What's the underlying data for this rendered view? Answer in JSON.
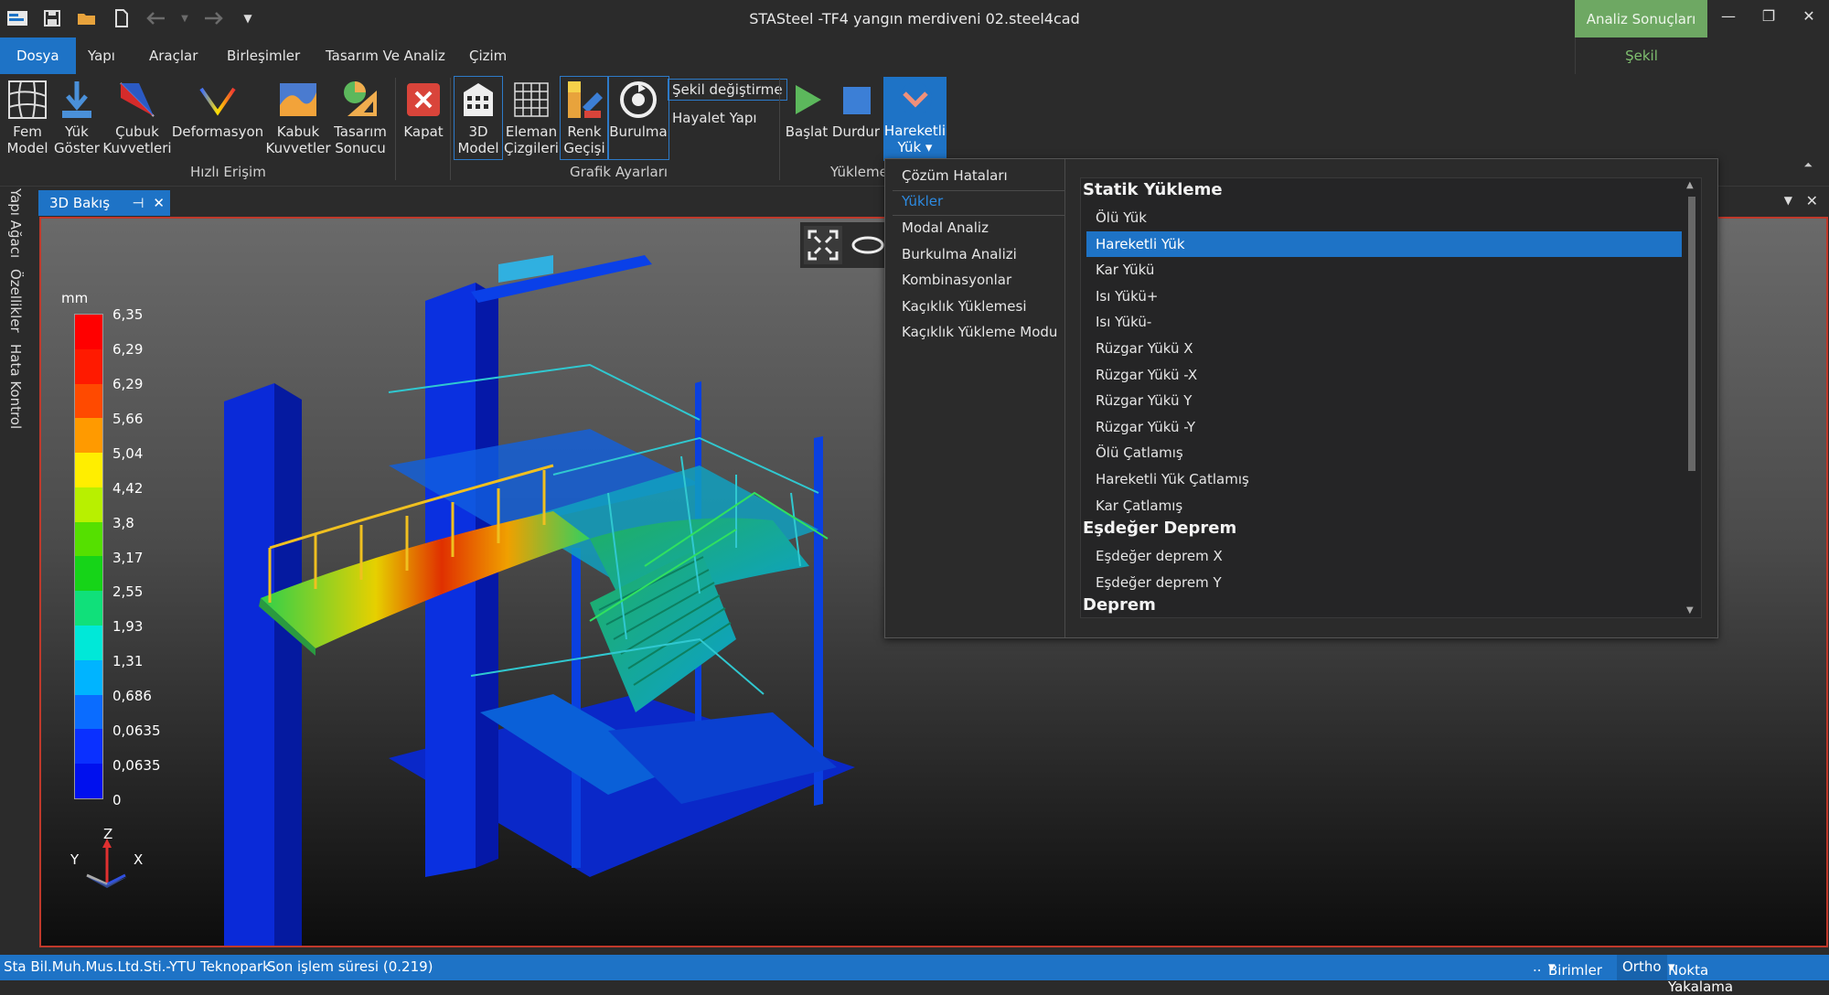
{
  "window": {
    "title": "STASteel -TF4 yangın merdiveni 02.steel4cad",
    "context_tab": "Analiz Sonuçları",
    "accent": "#1e73c6",
    "context_color": "#6ea863"
  },
  "menu": {
    "items": [
      "Dosya",
      "Yapı",
      "Araçlar",
      "Birleşimler",
      "Tasarım Ve Analiz",
      "Çizim"
    ],
    "active": "Dosya",
    "context_item": "Şekil değiştirme"
  },
  "ribbon": {
    "quick_access": {
      "label": "Hızlı Erişim",
      "fem_model": [
        "Fem",
        "Model"
      ],
      "yuk_goster": [
        "Yük",
        "Göster"
      ],
      "cubuk_kuvvetleri": [
        "Çubuk",
        "Kuvvetleri"
      ],
      "deformasyon": "Deformasyon",
      "kabuk_kuvvetler": [
        "Kabuk",
        "Kuvvetler"
      ],
      "tasarim_sonucu": [
        "Tasarım",
        "Sonucu"
      ],
      "kapat": "Kapat"
    },
    "graphics": {
      "label": "Grafik Ayarları",
      "model_3d": [
        "3D",
        "Model"
      ],
      "eleman_cizgileri": [
        "Eleman",
        "Çizgileri"
      ],
      "renk_gecisi": [
        "Renk",
        "Geçişi"
      ],
      "burulma": "Burulma",
      "sekil_degistirme": "Şekil değiştirme",
      "hayalet_yapi": "Hayalet Yapı"
    },
    "loading": {
      "label": "Yükleme",
      "baslat": "Başlat",
      "durdur": "Durdur",
      "hareketli_yuk": [
        "Hareketli",
        "Yük"
      ]
    }
  },
  "side_tabs": [
    "Yapı Ağacı",
    "Özellikler",
    "Hata Kontrol"
  ],
  "doc_tab": {
    "label": "3D Bakış"
  },
  "legend": {
    "unit": "mm",
    "ticks": [
      "6,35",
      "6,29",
      "6,29",
      "5,66",
      "5,04",
      "4,42",
      "3,8",
      "3,17",
      "2,55",
      "1,93",
      "1,31",
      "0,686",
      "0,0635",
      "0,0635",
      "0"
    ],
    "colors": [
      "#ff0000",
      "#ff1a00",
      "#ff4a00",
      "#ff9a00",
      "#ffee00",
      "#b8f000",
      "#55e000",
      "#16d418",
      "#10e07a",
      "#00e8d8",
      "#00b4ff",
      "#0a6cff",
      "#0a30ff",
      "#0010ee"
    ]
  },
  "axes": {
    "z": "Z",
    "y": "Y",
    "x": "X"
  },
  "dropdown": {
    "left": {
      "cozum_hatalari": "Çözüm Hataları",
      "yukler": "Yükler",
      "items": [
        "Modal Analiz",
        "Burkulma Analizi",
        "Kombinasyonlar",
        "Kaçıklık Yüklemesi",
        "Kaçıklık Yükleme Modu"
      ]
    },
    "groups": [
      {
        "header": "Statik Yükleme",
        "items": [
          "Ölü Yük",
          "Hareketli Yük",
          "Kar Yükü",
          "Isı Yükü+",
          "Isı Yükü-",
          "Rüzgar Yükü X",
          "Rüzgar Yükü -X",
          "Rüzgar Yükü Y",
          "Rüzgar Yükü -Y",
          "Ölü Çatlamış",
          "Hareketli Yük Çatlamış",
          "Kar Çatlamış"
        ]
      },
      {
        "header": "Eşdeğer Deprem",
        "items": [
          "Eşdeğer deprem X",
          "Eşdeğer deprem Y"
        ]
      },
      {
        "header": "Deprem",
        "items": []
      }
    ],
    "selected": "Hareketli Yük"
  },
  "status": {
    "company": "Sta Bil.Muh.Mus.Ltd.Sti.-YTU Teknopark",
    "last_op": "Son işlem süresi (0.219)",
    "dots": "..",
    "units": "Birimler",
    "ortho": "Ortho",
    "snap": "Nokta Yakalama"
  }
}
